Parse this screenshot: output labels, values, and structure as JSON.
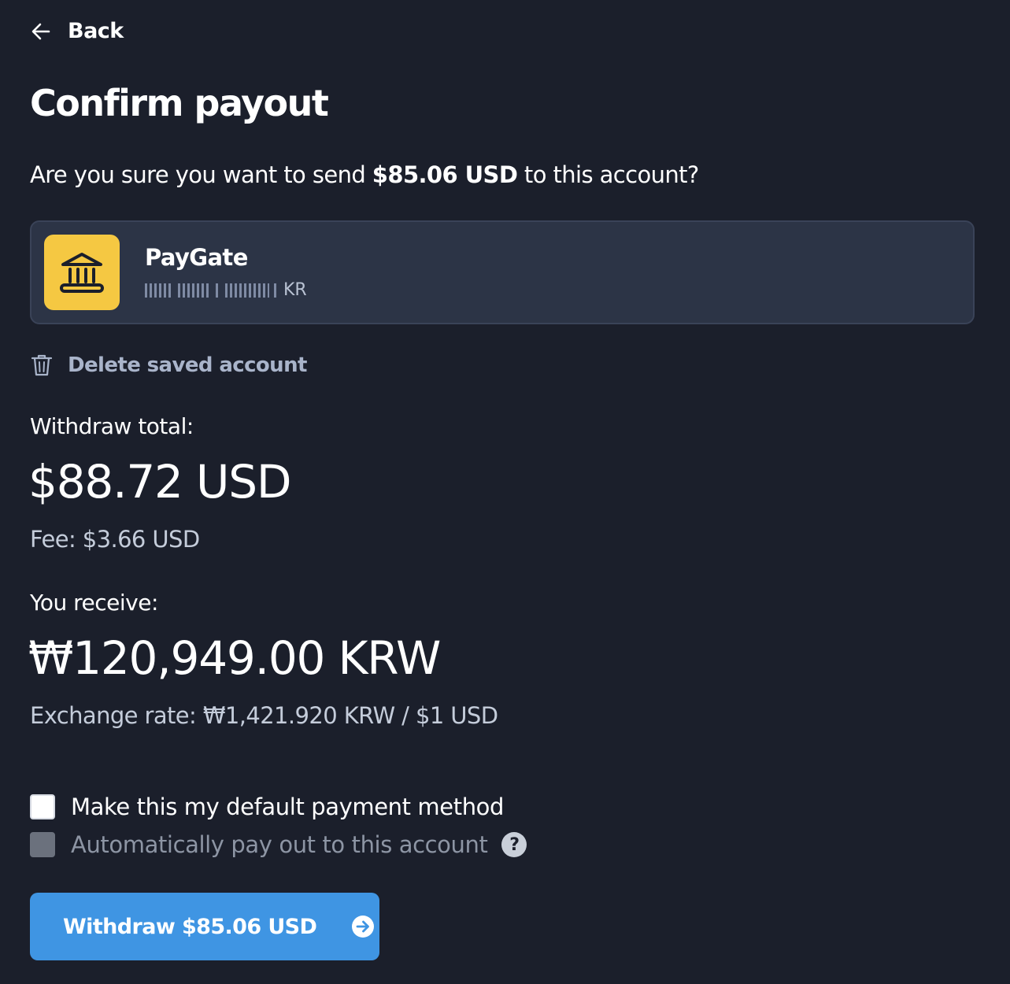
{
  "back": {
    "label": "Back",
    "icon": "arrow-left-icon"
  },
  "title": "Confirm payout",
  "confirm": {
    "prefix": "Are you sure you want to send",
    "amount": "$85.06 USD",
    "suffix": "to this account?"
  },
  "account": {
    "name": "PayGate",
    "country": "KR",
    "icon": "bank-icon",
    "badge_color": "#f5c842"
  },
  "delete_account": {
    "label": "Delete saved account",
    "icon": "trash-icon"
  },
  "withdraw_total": {
    "label": "Withdraw total:",
    "amount": "$88.72 USD",
    "fee": "Fee: $3.66 USD"
  },
  "receive": {
    "label": "You receive:",
    "amount": "₩120,949.00 KRW",
    "rate": "Exchange rate: ₩1,421.920 KRW / $1 USD"
  },
  "options": {
    "default_method": {
      "label": "Make this my default payment method",
      "checked": false
    },
    "auto_payout": {
      "label": "Automatically pay out to this account",
      "checked": false,
      "disabled": true,
      "help": "?"
    }
  },
  "withdraw_button": {
    "label": "Withdraw $85.06 USD",
    "icon": "arrow-right-circle-icon",
    "color": "#3f95e3"
  },
  "colors": {
    "background": "#1b1f2b",
    "card": "#2c3446",
    "accent": "#3f95e3",
    "muted": "#a9b4ca"
  }
}
